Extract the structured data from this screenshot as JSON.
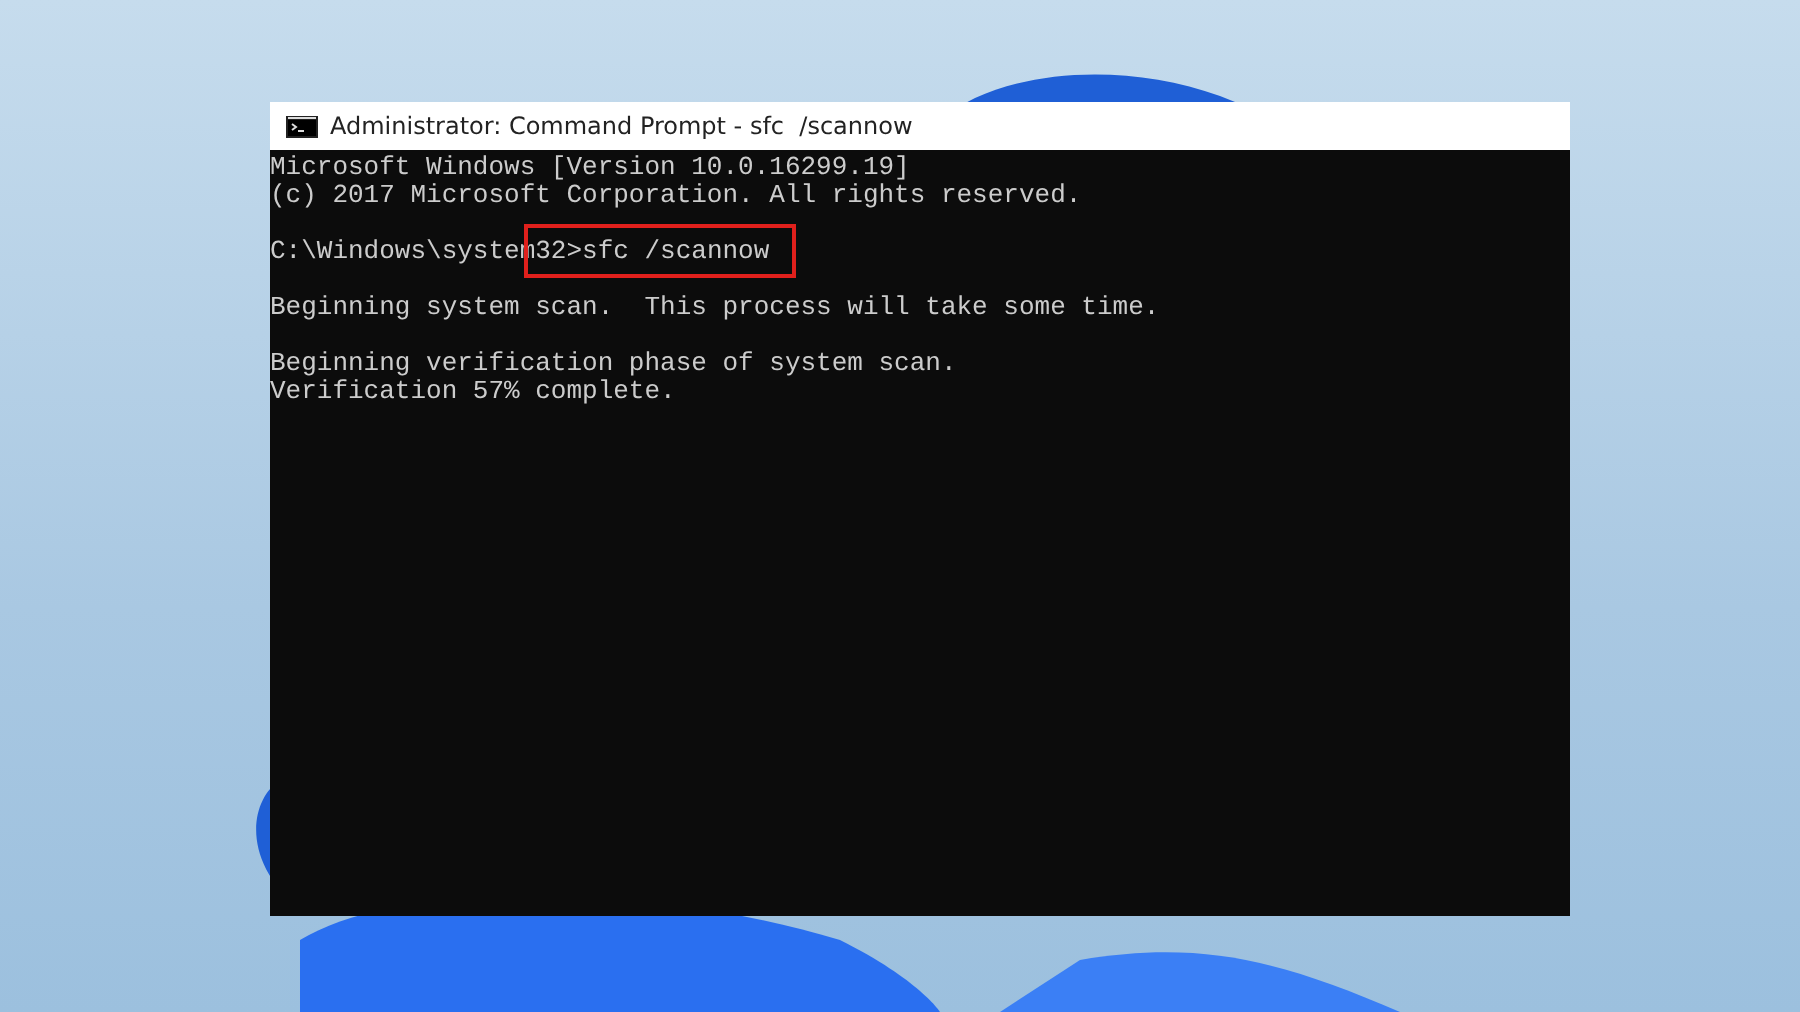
{
  "window": {
    "title": "Administrator: Command Prompt - sfc  /scannow"
  },
  "console": {
    "lines": [
      {
        "kind": "output",
        "text": "Microsoft Windows [Version 10.0.16299.19]"
      },
      {
        "kind": "output",
        "text": "(c) 2017 Microsoft Corporation. All rights reserved."
      },
      {
        "kind": "blank"
      },
      {
        "kind": "command",
        "prompt": "C:\\Windows\\system32>",
        "command": "sfc /scannow",
        "highlighted": true
      },
      {
        "kind": "blank"
      },
      {
        "kind": "output",
        "text": "Beginning system scan.  This process will take some time."
      },
      {
        "kind": "blank"
      },
      {
        "kind": "output",
        "text": "Beginning verification phase of system scan."
      },
      {
        "kind": "output",
        "text": "Verification 57% complete."
      }
    ]
  }
}
